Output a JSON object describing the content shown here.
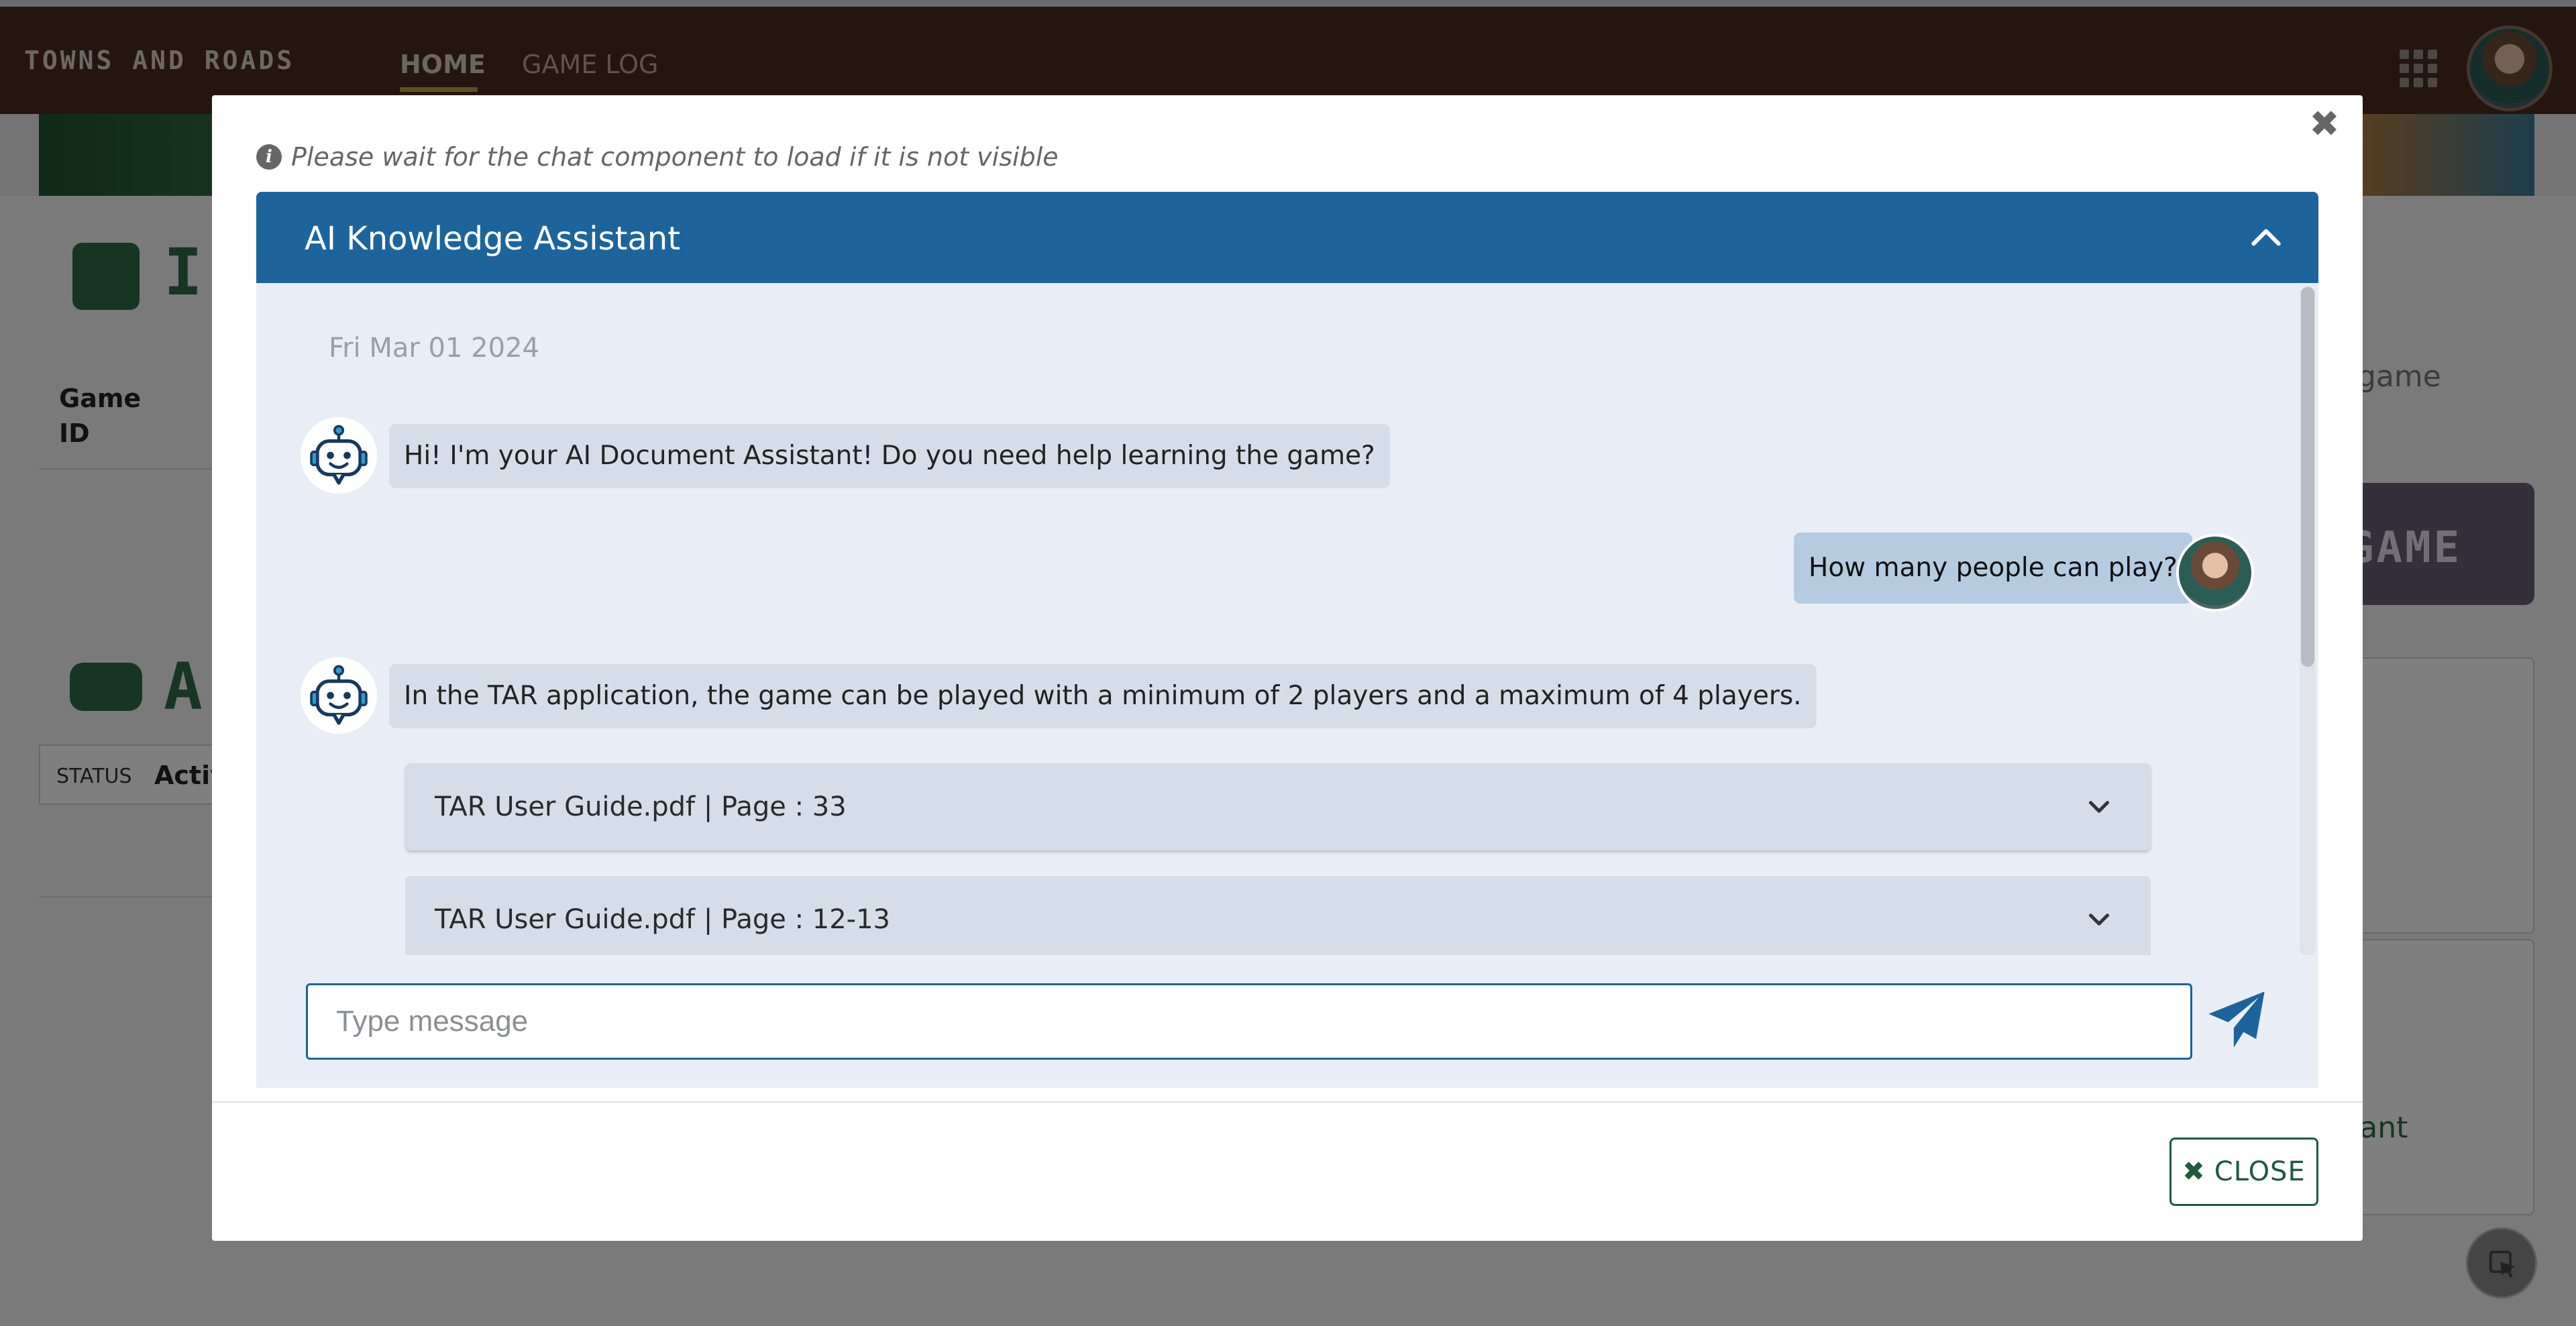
{
  "app": {
    "brand": "TOWNS AND ROADS",
    "nav": {
      "home": "HOME",
      "game_log": "GAME LOG"
    }
  },
  "background": {
    "title_fragment": "I",
    "game_id_label": "Game ID",
    "section_fragment": "A",
    "status_label": "STATUS",
    "status_value": "Activ",
    "right_text": "game",
    "new_game_fragment": "GAME",
    "assistant_fragment": "tant"
  },
  "modal": {
    "wait_notice": "Please wait for the chat component to load if it is not visible",
    "chat_title": "AI Knowledge Assistant",
    "date": "Fri Mar 01 2024",
    "messages": [
      {
        "from": "bot",
        "text": "Hi! I'm your AI Document Assistant! Do you need help learning the game?"
      },
      {
        "from": "user",
        "text": "How many people can play?"
      },
      {
        "from": "bot",
        "text": "In the TAR application, the game can be played with a minimum of 2 players and a maximum of 4 players."
      }
    ],
    "sources": [
      {
        "label": "TAR User Guide.pdf | Page : 33"
      },
      {
        "label": "TAR User Guide.pdf | Page : 12-13"
      }
    ],
    "input": {
      "placeholder": "Type message",
      "value": ""
    },
    "close_button": "CLOSE"
  },
  "colors": {
    "navbar": "#4a2b1f",
    "chat_header": "#1d649d",
    "chat_body": "#e9eef6",
    "bot_bubble": "#d5dee8",
    "user_bubble": "#b4cbe0",
    "close_button": "#1f5a3d"
  },
  "icons": [
    "apps-grid-icon",
    "info-icon",
    "chevron-up-icon",
    "robot-icon",
    "chevron-down-icon",
    "send-icon",
    "close-icon",
    "cursor-select-icon"
  ]
}
